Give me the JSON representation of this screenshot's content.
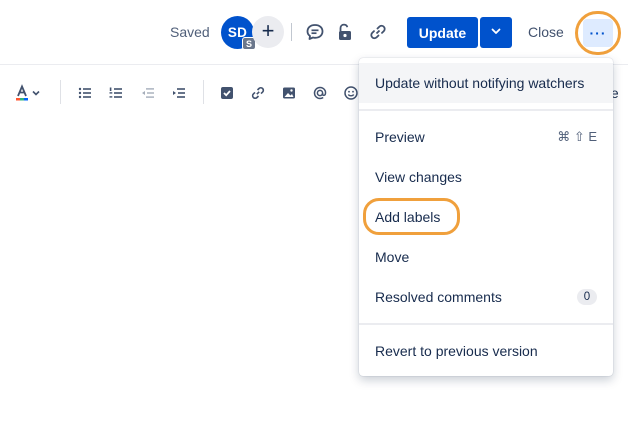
{
  "header": {
    "saved_text": "Saved",
    "avatar_initials": "SD",
    "avatar_badge": "S",
    "add_collaborator_label": "+",
    "update_label": "Update",
    "close_label": "Close",
    "more_label": "···",
    "icons": [
      "comment-icon",
      "unlock-icon",
      "link-icon",
      "chevron-down-icon"
    ]
  },
  "toolbar": {
    "trailing_text": "te",
    "icons": [
      "text-color-icon",
      "chevron-down-icon",
      "bullet-list-icon",
      "numbered-list-icon",
      "outdent-icon",
      "indent-icon",
      "task-checkbox-icon",
      "link-icon",
      "image-icon",
      "mention-icon",
      "emoji-icon"
    ]
  },
  "menu": {
    "items": [
      {
        "label": "Update without notifying watchers"
      },
      {
        "label": "Preview",
        "shortcut": "⌘ ⇧ E"
      },
      {
        "label": "View changes"
      },
      {
        "label": "Add labels"
      },
      {
        "label": "Move"
      },
      {
        "label": "Resolved comments",
        "count": "0"
      },
      {
        "label": "Revert to previous version"
      }
    ]
  },
  "colors": {
    "primary": "#0052cc",
    "highlight_ring": "#f0a03c",
    "menu_hover": "#f4f5f7"
  }
}
